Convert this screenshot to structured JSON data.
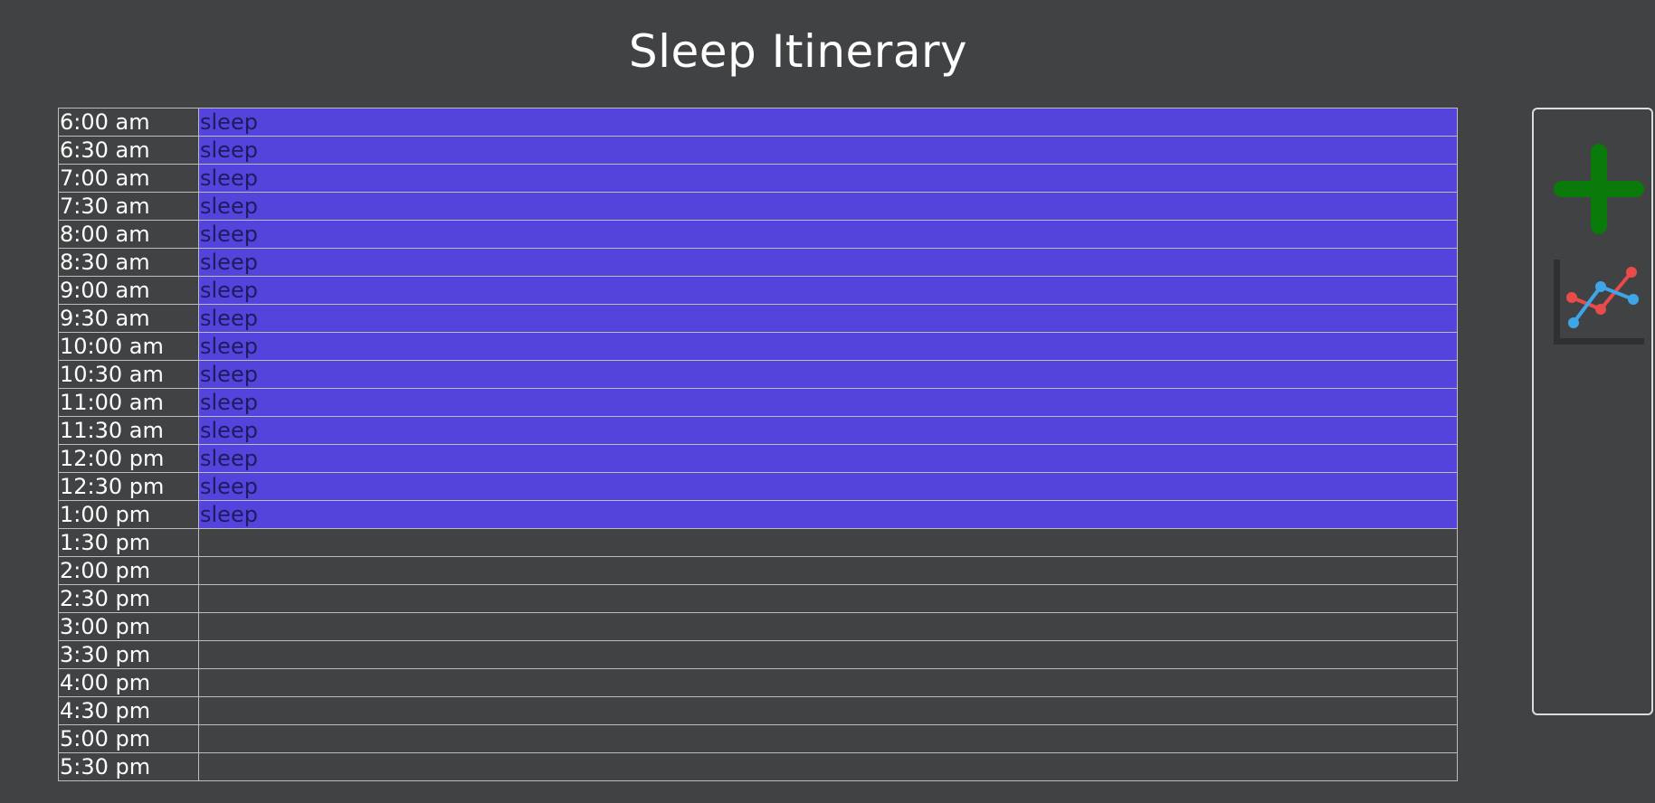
{
  "page": {
    "title": "Sleep Itinerary"
  },
  "colors": {
    "background": "#414244",
    "sleep_fill": "#5444dc",
    "sleep_text": "#1f1b5e",
    "add_icon": "#0a7a0a",
    "chart_red": "#e94b4b",
    "chart_blue": "#3ea6e8"
  },
  "schedule": {
    "rows": [
      {
        "time": "6:00 am",
        "activity": "sleep"
      },
      {
        "time": "6:30 am",
        "activity": "sleep"
      },
      {
        "time": "7:00 am",
        "activity": "sleep"
      },
      {
        "time": "7:30 am",
        "activity": "sleep"
      },
      {
        "time": "8:00 am",
        "activity": "sleep"
      },
      {
        "time": "8:30 am",
        "activity": "sleep"
      },
      {
        "time": "9:00 am",
        "activity": "sleep"
      },
      {
        "time": "9:30 am",
        "activity": "sleep"
      },
      {
        "time": "10:00 am",
        "activity": "sleep"
      },
      {
        "time": "10:30 am",
        "activity": "sleep"
      },
      {
        "time": "11:00 am",
        "activity": "sleep"
      },
      {
        "time": "11:30 am",
        "activity": "sleep"
      },
      {
        "time": "12:00 pm",
        "activity": "sleep"
      },
      {
        "time": "12:30 pm",
        "activity": "sleep"
      },
      {
        "time": "1:00 pm",
        "activity": "sleep"
      },
      {
        "time": "1:30 pm",
        "activity": ""
      },
      {
        "time": "2:00 pm",
        "activity": ""
      },
      {
        "time": "2:30 pm",
        "activity": ""
      },
      {
        "time": "3:00 pm",
        "activity": ""
      },
      {
        "time": "3:30 pm",
        "activity": ""
      },
      {
        "time": "4:00 pm",
        "activity": ""
      },
      {
        "time": "4:30 pm",
        "activity": ""
      },
      {
        "time": "5:00 pm",
        "activity": ""
      },
      {
        "time": "5:30 pm",
        "activity": ""
      }
    ]
  },
  "sidebar": {
    "buttons": [
      {
        "icon": "plus-icon",
        "action": "add-entry"
      },
      {
        "icon": "line-chart-icon",
        "action": "view-chart"
      }
    ]
  }
}
